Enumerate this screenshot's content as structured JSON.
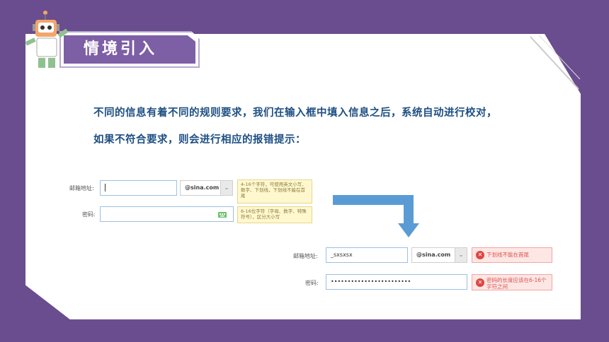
{
  "title": "情境引入",
  "intro": {
    "line1": "不同的信息有着不同的规则要求，我们在输入框中填入信息之后，系统自动进行校对，",
    "line2": "如果不符合要求，则会进行相应的报错提示："
  },
  "form_before": {
    "email_label": "邮箱地址:",
    "email_value": "",
    "domain_value": "@sina.com",
    "email_tip": "4-16个字符，可使用英文小写、数字、下划线，下划线不能在首尾",
    "password_label": "密码:",
    "password_value": "",
    "password_tip": "6-16位字符（字母、数字、特殊符号），区分大小写"
  },
  "form_after": {
    "email_label": "邮箱地址:",
    "email_value": "_sxsxsx",
    "domain_value": "@sina.com",
    "email_error": "下划线不能在首尾",
    "password_label": "密码:",
    "password_value": "••••••••••••••••••••••••",
    "password_error": "密码的长度应该在6-16个字符之间"
  },
  "colors": {
    "background": "#6a4d8e",
    "title_bg": "#7d5fa6",
    "intro_text": "#1d4f83",
    "arrow": "#5b9bd5",
    "error": "#d9534f"
  },
  "icons": {
    "keyboard": "keyboard-icon",
    "error": "error-icon",
    "dropdown": "chevron-down-icon",
    "arrow": "arrow-down-icon",
    "robot": "robot-mascot"
  }
}
